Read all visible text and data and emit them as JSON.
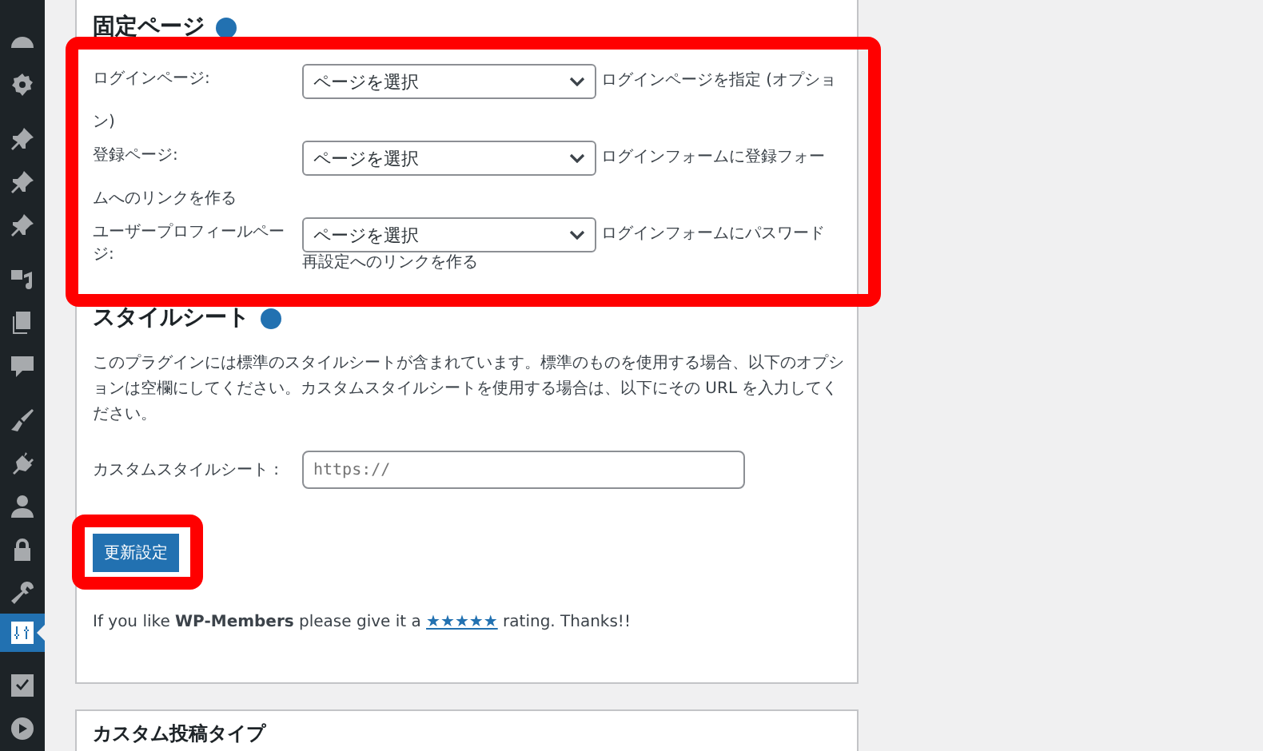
{
  "sidebar": {
    "items": [
      {
        "selected": false
      },
      {
        "selected": false
      },
      {
        "selected": false
      },
      {
        "selected": false
      },
      {
        "selected": false
      },
      {
        "selected": false
      },
      {
        "selected": false
      },
      {
        "selected": false
      },
      {
        "selected": false
      },
      {
        "selected": false
      },
      {
        "selected": false
      },
      {
        "selected": false
      },
      {
        "selected": false
      },
      {
        "selected": true
      },
      {
        "selected": false
      },
      {
        "selected": false
      }
    ]
  },
  "pages_section": {
    "title": "固定ページ",
    "rows": [
      {
        "kind": "short-label",
        "label": "ログインページ:",
        "select": "ページを選択",
        "description_lines": [
          "ログインページを指定 (オプショ",
          "ン)"
        ]
      },
      {
        "kind": "short-label",
        "label": "登録ページ:",
        "select": "ページを選択",
        "description_lines": [
          "ログインフォームに登録フォー",
          "ムへのリンクを作る"
        ]
      },
      {
        "kind": "long-label",
        "label": "ユーザープロフィールページ:",
        "select": "ページを選択",
        "description_lines": [
          "ログインフォームにパスワード",
          "再設定へのリンクを作る"
        ]
      }
    ]
  },
  "stylesheet_section": {
    "title": "スタイルシート",
    "description": "このプラグインには標準のスタイルシートが含まれています。標準のものを使用する場合、以下のオプションは空欄にしてください。カスタムスタイルシートを使用する場合は、以下にその URL を入力してください。",
    "field_label": "カスタムスタイルシート :",
    "field_placeholder": "https://"
  },
  "save_button": "更新設定",
  "rating": {
    "before": "If you like **WP-Members** please give it a ",
    "link": "★★★★★",
    "after": " rating. Thanks!!"
  },
  "next_section": {
    "title": "カスタム投稿タイプ"
  }
}
